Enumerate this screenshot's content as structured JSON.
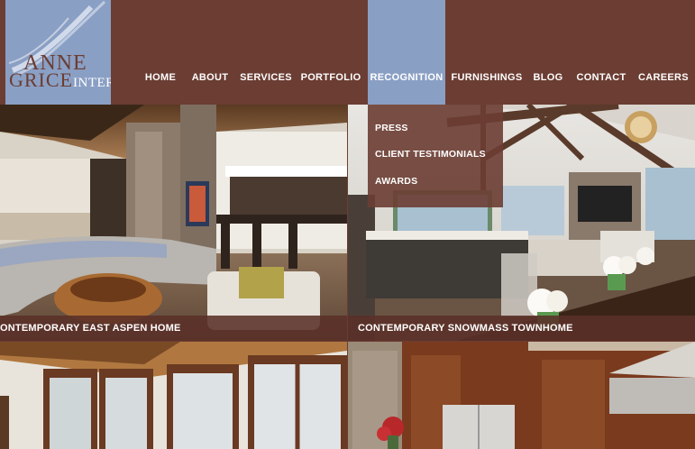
{
  "logo": {
    "line1": "ANNE",
    "line2_big": "GRICE",
    "line2_small": "INTERIORS"
  },
  "nav": {
    "items": [
      {
        "label": "HOME"
      },
      {
        "label": "ABOUT"
      },
      {
        "label": "SERVICES"
      },
      {
        "label": "PORTFOLIO"
      },
      {
        "label": "RECOGNITION"
      },
      {
        "label": "FURNISHINGS"
      },
      {
        "label": "BLOG"
      },
      {
        "label": "CONTACT"
      },
      {
        "label": "CAREERS"
      }
    ],
    "active": "RECOGNITION"
  },
  "dropdown": {
    "items": [
      {
        "label": "PRESS"
      },
      {
        "label": "CLIENT TESTIMONIALS"
      },
      {
        "label": "AWARDS"
      }
    ]
  },
  "portfolio": {
    "tiles": [
      {
        "caption": "ONTEMPORARY EAST ASPEN HOME"
      },
      {
        "caption": "CONTEMPORARY SNOWMASS TOWNHOME"
      },
      {
        "caption": ""
      },
      {
        "caption": ""
      }
    ]
  },
  "colors": {
    "brand": "#6b3d33",
    "accent": "#8a9fc4"
  }
}
